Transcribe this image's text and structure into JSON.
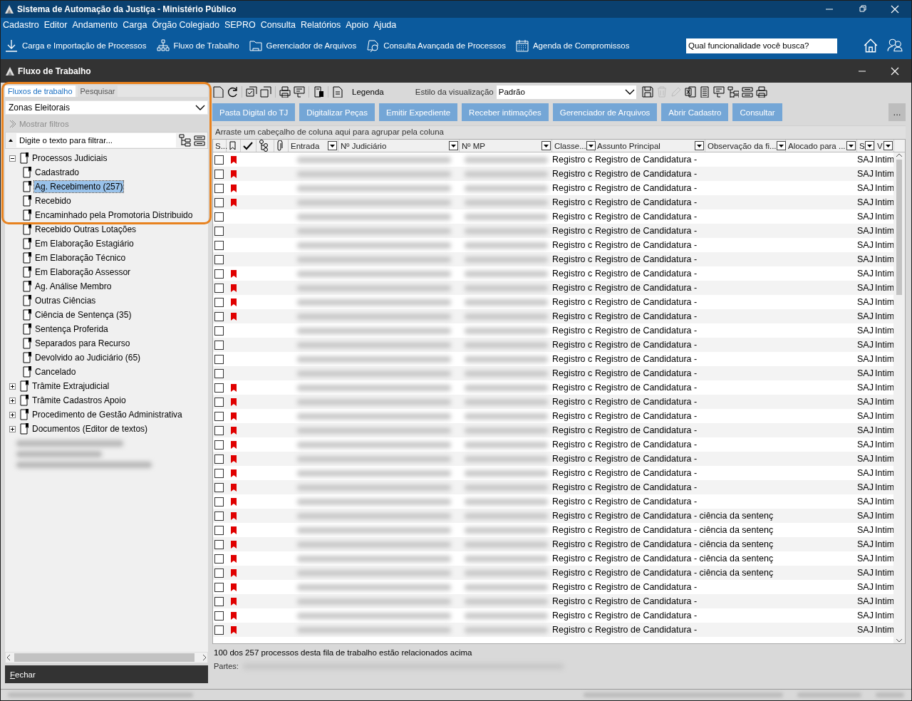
{
  "window": {
    "title": "Sistema de Automação da Justiça - Ministério Público"
  },
  "menu": [
    "Cadastro",
    "Editor",
    "Andamento",
    "Carga",
    "Órgão Colegiado",
    "SEPRO",
    "Consulta",
    "Relatórios",
    "Apoio",
    "Ajuda"
  ],
  "toolbar": [
    {
      "label": "Carga e Importação de Processos",
      "kind": "download"
    },
    {
      "label": "Fluxo de Trabalho",
      "kind": "hierarchy"
    },
    {
      "label": "Gerenciador de Arquivos",
      "kind": "folder"
    },
    {
      "label": "Consulta Avançada de Processos",
      "kind": "search-doc"
    },
    {
      "label": "Agenda de Compromissos",
      "kind": "calendar"
    }
  ],
  "search": {
    "placeholder": "Qual funcionalidade você busca?"
  },
  "panel": {
    "title": "Fluxo de Trabalho"
  },
  "sidebar": {
    "tabs": [
      {
        "label": "Fluxos de trabalho",
        "selected": true
      },
      {
        "label": "Pesquisar",
        "selected": false
      }
    ],
    "dropdown": "Zonas Eleitorais",
    "show_filters": {
      "label": "Mostrar filtros",
      "disabled": true
    },
    "filter": {
      "placeholder": "Digite o texto para filtrar..."
    },
    "tree": [
      {
        "label": "Processos Judiciais",
        "expanded": true,
        "selected": false,
        "children": [
          {
            "label": "Cadastrado",
            "selected": false
          },
          {
            "label": "Ag. Recebimento (257)",
            "selected": true
          },
          {
            "label": "Recebido",
            "selected": false
          },
          {
            "label": "Encaminhado pela Promotoria Distribuido",
            "selected": false
          },
          {
            "label": "Recebido Outras Lotações",
            "selected": false
          },
          {
            "label": "Em Elaboração Estagiário",
            "selected": false
          },
          {
            "label": "Em Elaboração Técnico",
            "selected": false
          },
          {
            "label": "Em Elaboração Assessor",
            "selected": false
          },
          {
            "label": "Ag. Análise Membro",
            "selected": false
          },
          {
            "label": "Outras Ciências",
            "selected": false
          },
          {
            "label": "Ciência de Sentença (35)",
            "selected": false
          },
          {
            "label": "Sentença Proferida",
            "selected": false
          },
          {
            "label": "Separados para Recurso",
            "selected": false
          },
          {
            "label": "Devolvido ao Judiciário (65)",
            "selected": false
          },
          {
            "label": "Cancelado",
            "selected": false
          }
        ]
      },
      {
        "label": "Trâmite Extrajudicial",
        "expanded": false,
        "selected": false
      },
      {
        "label": "Trâmite Cadastros Apoio",
        "expanded": false,
        "selected": false
      },
      {
        "label": "Procedimento de Gestão Administrativa",
        "expanded": false,
        "selected": false
      },
      {
        "label": "Documentos (Editor de textos)",
        "expanded": false,
        "selected": false
      }
    ],
    "close_button": "Fechar"
  },
  "grid_toolbar": {
    "legend": "Legenda",
    "view_style_label": "Estilo da visualização",
    "view_style": "Padrão"
  },
  "actions": [
    "Pasta Digital do TJ",
    "Digitalizar Peças",
    "Emitir Expediente",
    "Receber intimações",
    "Gerenciador de Arquivos",
    "Abrir Cadastro",
    "Consultar"
  ],
  "more_button": "...",
  "group_hint": "Arraste um cabeçalho de coluna aqui para agrupar pela coluna",
  "table": {
    "columns": [
      {
        "kind": "text",
        "label": "S..."
      },
      {
        "kind": "flag",
        "filter": false
      },
      {
        "kind": "check",
        "filter": false
      },
      {
        "kind": "tree",
        "filter": false
      },
      {
        "kind": "clip",
        "filter": false
      },
      {
        "kind": "text",
        "label": "Entrada",
        "filter": true
      },
      {
        "kind": "text",
        "label": "Nº Judiciário",
        "filter": true
      },
      {
        "kind": "text",
        "label": "Nº MP",
        "filter": true
      },
      {
        "kind": "text",
        "label": "Classe...",
        "filter": true
      },
      {
        "kind": "text",
        "label": "Assunto Principal",
        "filter": true
      },
      {
        "kind": "text",
        "label": "Observação da fi...",
        "filter": true
      },
      {
        "kind": "text",
        "label": "Alocado para ...",
        "filter": true
      },
      {
        "kind": "text",
        "label": "S",
        "filter": true
      },
      {
        "kind": "text",
        "label": "V",
        "filter": true
      }
    ],
    "rows": [
      {
        "checked": false,
        "flagged": true,
        "classe": "Registro c",
        "assunto": "Registro de Candidatura -",
        "s": "SAJ",
        "v": "Intim"
      },
      {
        "checked": false,
        "flagged": true,
        "classe": "Registro c",
        "assunto": "Registro de Candidatura -",
        "s": "SAJ",
        "v": "Intim"
      },
      {
        "checked": false,
        "flagged": true,
        "classe": "Registro c",
        "assunto": "Registro de Candidatura -",
        "s": "SAJ",
        "v": "Intim"
      },
      {
        "checked": false,
        "flagged": true,
        "classe": "Registro c",
        "assunto": "Registro de Candidatura -",
        "s": "SAJ",
        "v": "Intim"
      },
      {
        "checked": false,
        "flagged": false,
        "classe": "Registro c",
        "assunto": "Registro de Candidatura -",
        "s": "SAJ",
        "v": "Intim"
      },
      {
        "checked": false,
        "flagged": false,
        "classe": "Registro c",
        "assunto": "Registro de Candidatura -",
        "s": "SAJ",
        "v": "Intim"
      },
      {
        "checked": false,
        "flagged": false,
        "classe": "Registro c",
        "assunto": "Registro de Candidatura -",
        "s": "SAJ",
        "v": "Intim"
      },
      {
        "checked": false,
        "flagged": false,
        "classe": "Registro c",
        "assunto": "Registro de Candidatura -",
        "s": "SAJ",
        "v": "Intim"
      },
      {
        "checked": false,
        "flagged": true,
        "classe": "Registro c",
        "assunto": "Registro de Candidatura -",
        "s": "SAJ",
        "v": "Intim"
      },
      {
        "checked": false,
        "flagged": true,
        "classe": "Registro c",
        "assunto": "Registro de Candidatura -",
        "s": "SAJ",
        "v": "Intim"
      },
      {
        "checked": false,
        "flagged": true,
        "classe": "Registro c",
        "assunto": "Registro de Candidatura -",
        "s": "SAJ",
        "v": "Intim"
      },
      {
        "checked": false,
        "flagged": true,
        "classe": "Registro c",
        "assunto": "Registro de Candidatura -",
        "s": "SAJ",
        "v": "Intim"
      },
      {
        "checked": false,
        "flagged": false,
        "classe": "Registro c",
        "assunto": "Registro de Candidatura -",
        "s": "SAJ",
        "v": "Intim"
      },
      {
        "checked": false,
        "flagged": false,
        "classe": "Registro c",
        "assunto": "Registro de Candidatura -",
        "s": "SAJ",
        "v": "Intim"
      },
      {
        "checked": false,
        "flagged": false,
        "classe": "Registro c",
        "assunto": "Registro de Candidatura -",
        "s": "SAJ",
        "v": "Intim"
      },
      {
        "checked": false,
        "flagged": false,
        "classe": "Registro c",
        "assunto": "Registro de Candidatura -",
        "s": "SAJ",
        "v": "Intim"
      },
      {
        "checked": false,
        "flagged": true,
        "classe": "Registro c",
        "assunto": "Registro de Candidatura -",
        "s": "SAJ",
        "v": "Intim"
      },
      {
        "checked": false,
        "flagged": true,
        "classe": "Registro c",
        "assunto": "Registro de Candidatura -",
        "s": "SAJ",
        "v": "Intim"
      },
      {
        "checked": false,
        "flagged": true,
        "classe": "Registro c",
        "assunto": "Registro de Candidatura -",
        "s": "SAJ",
        "v": "Intim"
      },
      {
        "checked": false,
        "flagged": true,
        "classe": "Registro c",
        "assunto": "Registro de Candidatura -",
        "s": "SAJ",
        "v": "Intim"
      },
      {
        "checked": false,
        "flagged": true,
        "classe": "Registro c",
        "assunto": "Registro de Candidatura -",
        "s": "SAJ",
        "v": "Intim"
      },
      {
        "checked": false,
        "flagged": true,
        "classe": "Registro c",
        "assunto": "Registro de Candidatura -",
        "s": "SAJ",
        "v": "Intim"
      },
      {
        "checked": false,
        "flagged": true,
        "classe": "Registro c",
        "assunto": "Registro de Candidatura -",
        "s": "SAJ",
        "v": "Intim"
      },
      {
        "checked": false,
        "flagged": true,
        "classe": "Registro c",
        "assunto": "Registro de Candidatura -",
        "s": "SAJ",
        "v": "Intim"
      },
      {
        "checked": false,
        "flagged": true,
        "classe": "Registro c",
        "assunto": "Registro de Candidatura -",
        "s": "SAJ",
        "v": "Intim"
      },
      {
        "checked": false,
        "flagged": true,
        "classe": "Registro c",
        "assunto": "Registro de Candidatura - ciência da sentenç",
        "s": "SAJ",
        "v": "Intim"
      },
      {
        "checked": false,
        "flagged": true,
        "classe": "Registro c",
        "assunto": "Registro de Candidatura - ciência da sentenç",
        "s": "SAJ",
        "v": "Intim"
      },
      {
        "checked": false,
        "flagged": true,
        "classe": "Registro c",
        "assunto": "Registro de Candidatura - ciência da sentenç",
        "s": "SAJ",
        "v": "Intim"
      },
      {
        "checked": false,
        "flagged": true,
        "classe": "Registro c",
        "assunto": "Registro de Candidatura - ciência da sentenç",
        "s": "SAJ",
        "v": "Intim"
      },
      {
        "checked": false,
        "flagged": true,
        "classe": "Registro c",
        "assunto": "Registro de Candidatura - ciência da sentenç",
        "s": "SAJ",
        "v": "Intim"
      },
      {
        "checked": false,
        "flagged": true,
        "classe": "Registro c",
        "assunto": "Registro de Candidatura -",
        "s": "SAJ",
        "v": "Intim"
      },
      {
        "checked": false,
        "flagged": true,
        "classe": "Registro c",
        "assunto": "Registro de Candidatura -",
        "s": "SAJ",
        "v": "Intim"
      },
      {
        "checked": false,
        "flagged": true,
        "classe": "Registro c",
        "assunto": "Registro de Candidatura -",
        "s": "SAJ",
        "v": "Intim"
      },
      {
        "checked": false,
        "flagged": true,
        "classe": "Registro c",
        "assunto": "Registro de Candidatura -",
        "s": "SAJ",
        "v": "Intim"
      }
    ]
  },
  "footer": {
    "summary": "100 dos 257 processos desta fila de trabalho estão relacionados acima",
    "parties_label": "Partes:"
  }
}
